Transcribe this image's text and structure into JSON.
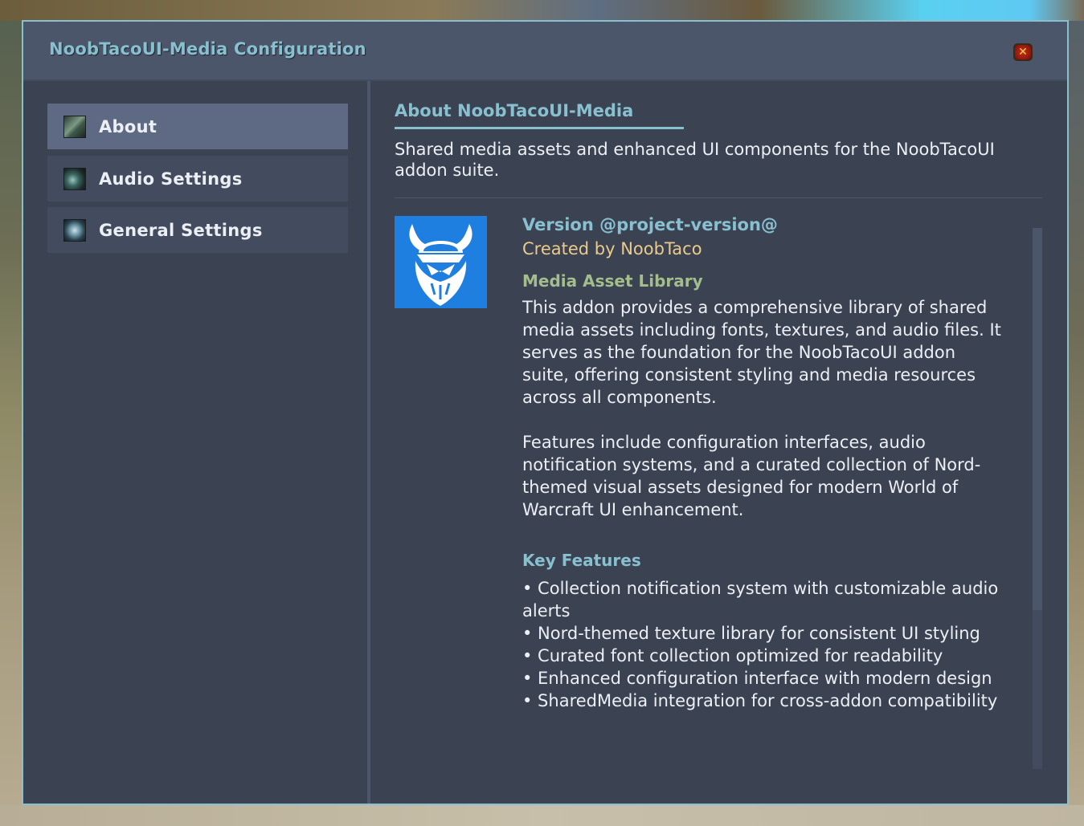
{
  "window": {
    "title": "NoobTacoUI-Media Configuration",
    "close_label": "✕"
  },
  "sidebar": {
    "items": [
      {
        "label": "About",
        "icon": "scroll-icon",
        "active": true
      },
      {
        "label": "Audio Settings",
        "icon": "audio-icon",
        "active": false
      },
      {
        "label": "General Settings",
        "icon": "gear-icon",
        "active": false
      }
    ]
  },
  "main": {
    "title": "About NoobTacoUI-Media",
    "subtitle": "Shared media assets and enhanced UI components for the NoobTacoUI addon suite.",
    "version": "Version @project-version@",
    "author": "Created by NoobTaco",
    "library_heading": "Media Asset Library",
    "description": "This addon provides a comprehensive library of shared media assets including fonts, textures, and audio files. It serves as the foundation for the NoobTacoUI addon suite, offering consistent styling and media resources across all components.\n\nFeatures include configuration interfaces, audio notification systems, and a curated collection of Nord-themed visual assets designed for modern World of Warcraft UI enhancement.",
    "features_heading": "Key Features",
    "features": [
      "• Collection notification system with customizable audio alerts",
      "• Nord-themed texture library for consistent UI styling",
      "• Curated font collection optimized for readability",
      "• Enhanced configuration interface with modern design",
      "• SharedMedia integration for cross-addon compatibility"
    ]
  },
  "colors": {
    "accent": "#88c0d0",
    "author": "#ebcb8b",
    "heading_green": "#a3be8c",
    "text": "#eceff4",
    "panel": "#3b4252",
    "logo_bg": "#1f7fe0"
  }
}
